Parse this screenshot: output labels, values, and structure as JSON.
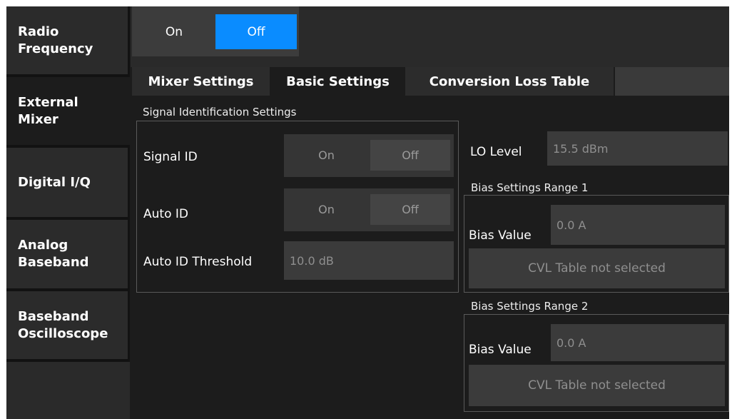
{
  "sidebar": {
    "items": [
      {
        "line1": "Radio",
        "line2": "Frequency"
      },
      {
        "line1": "External",
        "line2": "Mixer"
      },
      {
        "line1": "Digital I/Q",
        "line2": ""
      },
      {
        "line1": "Analog",
        "line2": "Baseband"
      },
      {
        "line1": "Baseband",
        "line2": "Oscilloscope"
      }
    ]
  },
  "topbar": {
    "on_label": "On",
    "off_label": "Off"
  },
  "tabs": [
    {
      "label": "Mixer Settings"
    },
    {
      "label": "Basic Settings"
    },
    {
      "label": "Conversion Loss Table"
    }
  ],
  "signal_id_section": {
    "title": "Signal Identification Settings",
    "signal_id": {
      "label": "Signal ID",
      "on": "On",
      "off": "Off"
    },
    "auto_id": {
      "label": "Auto ID",
      "on": "On",
      "off": "Off"
    },
    "auto_id_threshold": {
      "label": "Auto ID Threshold",
      "value": "10.0 dB"
    }
  },
  "lo_level": {
    "label": "LO Level",
    "value": "15.5 dBm"
  },
  "bias_range_1": {
    "title": "Bias Settings Range 1",
    "bias_label": "Bias Value",
    "bias_value": "0.0 A",
    "cvl_button": "CVL Table not selected"
  },
  "bias_range_2": {
    "title": "Bias Settings Range 2",
    "bias_label": "Bias Value",
    "bias_value": "0.0 A",
    "cvl_button": "CVL Table not selected"
  },
  "colors": {
    "accent": "#0a8cff",
    "background": "#1c1c1c"
  }
}
